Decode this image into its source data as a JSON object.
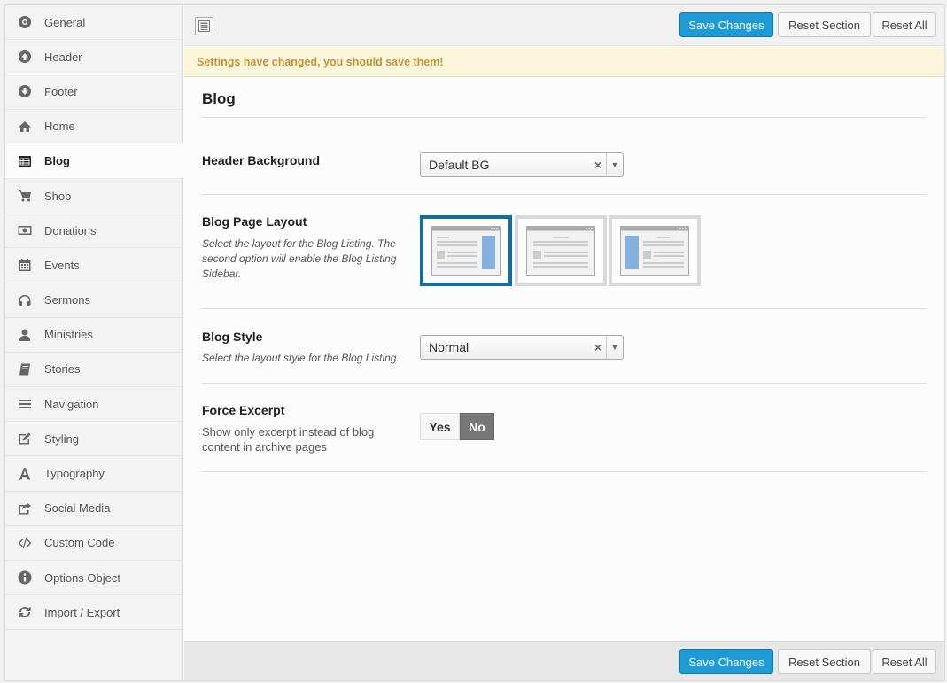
{
  "sidebar": {
    "items": [
      {
        "label": "General",
        "icon": "info-circle-icon"
      },
      {
        "label": "Header",
        "icon": "arrow-up-circle-icon"
      },
      {
        "label": "Footer",
        "icon": "arrow-down-circle-icon"
      },
      {
        "label": "Home",
        "icon": "home-icon"
      },
      {
        "label": "Blog",
        "icon": "list-alt-icon",
        "active": true
      },
      {
        "label": "Shop",
        "icon": "shopping-cart-icon"
      },
      {
        "label": "Donations",
        "icon": "money-icon"
      },
      {
        "label": "Events",
        "icon": "calendar-icon"
      },
      {
        "label": "Sermons",
        "icon": "headphones-icon"
      },
      {
        "label": "Ministries",
        "icon": "user-icon"
      },
      {
        "label": "Stories",
        "icon": "book-icon"
      },
      {
        "label": "Navigation",
        "icon": "bars-icon"
      },
      {
        "label": "Styling",
        "icon": "edit-icon"
      },
      {
        "label": "Typography",
        "icon": "font-icon"
      },
      {
        "label": "Social Media",
        "icon": "share-icon"
      },
      {
        "label": "Custom Code",
        "icon": "code-icon"
      },
      {
        "label": "Options Object",
        "icon": "info-icon"
      },
      {
        "label": "Import / Export",
        "icon": "refresh-icon"
      }
    ]
  },
  "toolbar": {
    "save_label": "Save Changes",
    "reset_section_label": "Reset Section",
    "reset_all_label": "Reset All"
  },
  "notice": "Settings have changed, you should save them!",
  "section": {
    "title": "Blog",
    "header_background": {
      "label": "Header Background",
      "value": "Default BG"
    },
    "page_layout": {
      "label": "Blog Page Layout",
      "description": "Select the layout for the Blog Listing. The second option will enable the Blog Listing Sidebar.",
      "selected_index": 0
    },
    "blog_style": {
      "label": "Blog Style",
      "description": "Select the layout style for the Blog Listing.",
      "value": "Normal"
    },
    "force_excerpt": {
      "label": "Force Excerpt",
      "description": "Show only excerpt instead of blog content in archive pages",
      "yes_label": "Yes",
      "no_label": "No",
      "value": "No"
    }
  },
  "colors": {
    "primary": "#1e9ad6",
    "selected_border": "#0f6fa1",
    "notice_text": "#c09636",
    "notice_bg": "#fcf6dc"
  }
}
